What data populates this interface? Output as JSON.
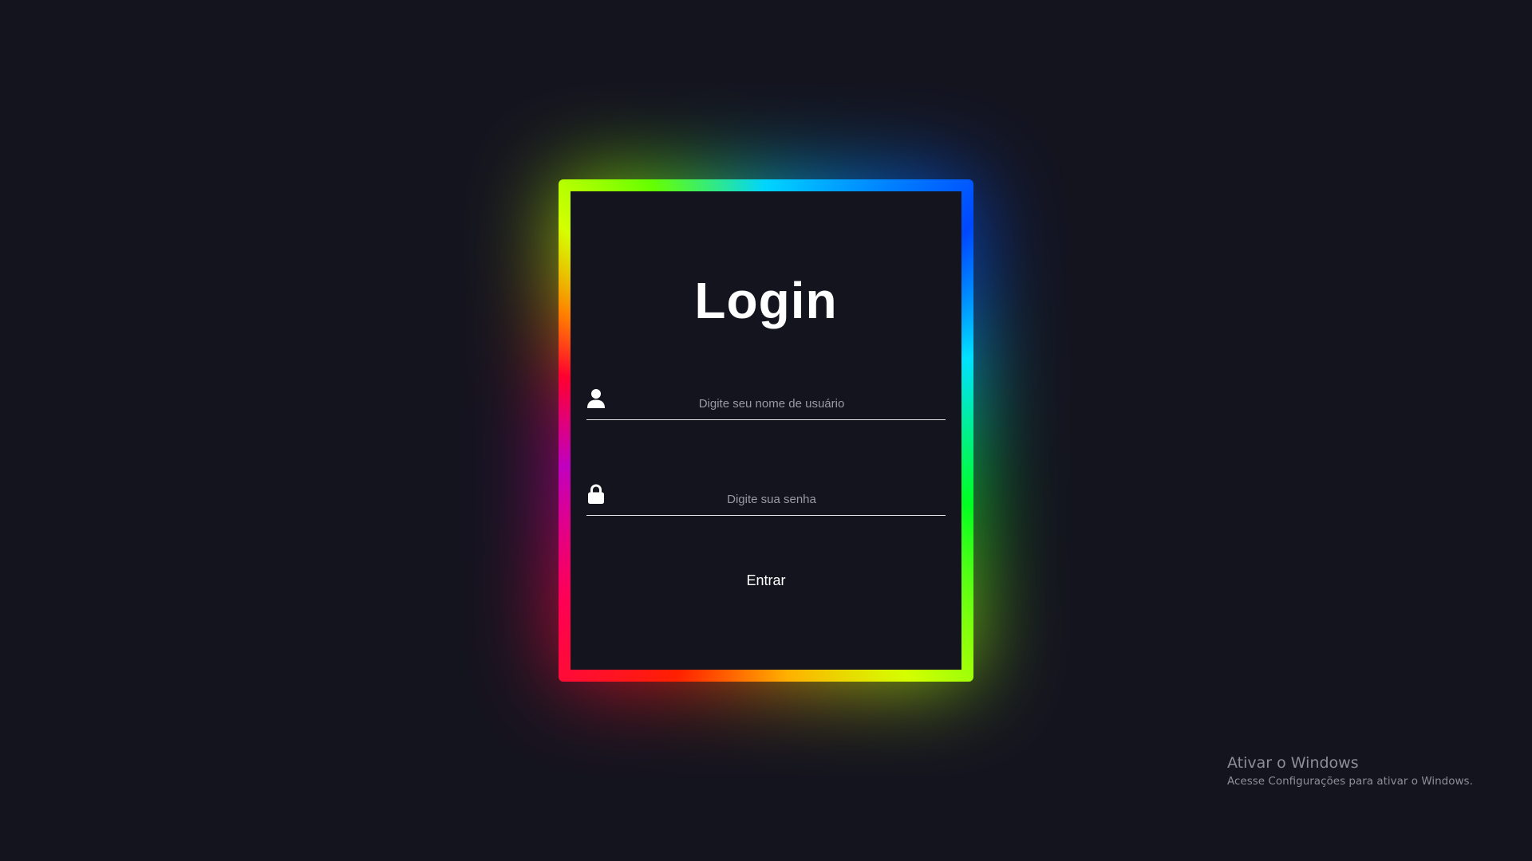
{
  "login": {
    "title": "Login",
    "username": {
      "placeholder": "Digite seu nome de usuário",
      "value": "",
      "icon": "user-icon"
    },
    "password": {
      "placeholder": "Digite sua senha",
      "value": "",
      "icon": "lock-icon"
    },
    "submit_label": "Entrar"
  },
  "watermark": {
    "title": "Ativar o Windows",
    "subtitle": "Acesse Configurações para ativar o Windows."
  },
  "colors": {
    "background": "#14141f",
    "text": "#ffffff",
    "placeholder": "#9a9aa6",
    "border_gradient": [
      "#00d4ff",
      "#0048ff",
      "#00ff22",
      "#d4ff00",
      "#ffb000",
      "#ff2000",
      "#ff0055",
      "#c000c0"
    ]
  }
}
